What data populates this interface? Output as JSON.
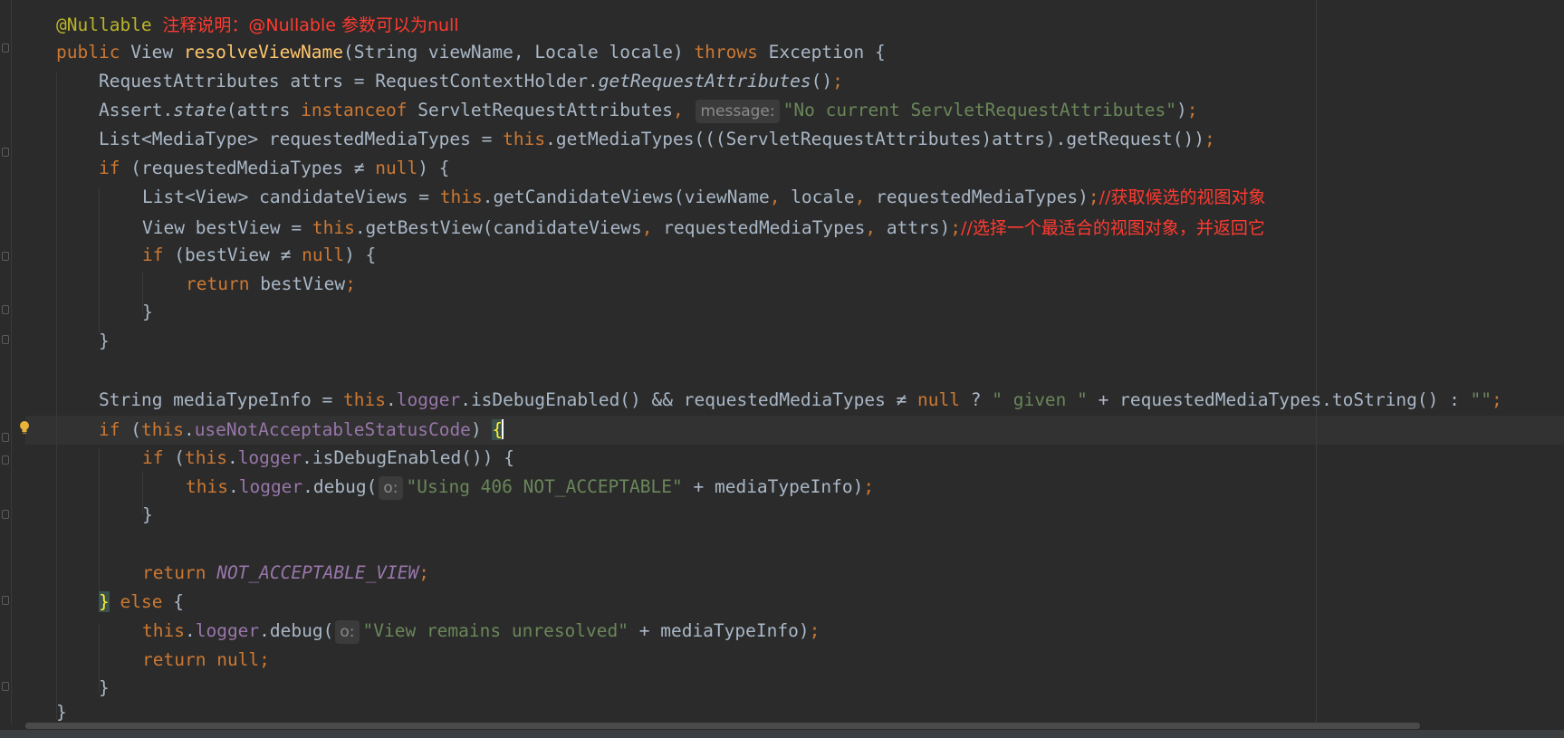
{
  "editor": {
    "annotation": "@Nullable",
    "annotation_comment": "注释说明：@Nullable 参数可以为null",
    "lines": {
      "l2": {
        "kw_public": "public",
        "type_view": " View ",
        "method": "resolveViewName",
        "params": "(String viewName, Locale locale) ",
        "kw_throws": "throws",
        "rest": " Exception {"
      },
      "l3": {
        "a": "RequestAttributes attrs = RequestContextHolder.",
        "m": "getRequestAttributes",
        "b": "()",
        "semi": ";"
      },
      "l4": {
        "a": "Assert.",
        "m": "state",
        "b": "(attrs ",
        "kw": "instanceof",
        "c": " ServletRequestAttributes",
        "comma": ",",
        "hint": "message:",
        "str": "\"No current ServletRequestAttributes\"",
        "d": ")",
        "semi": ";"
      },
      "l5": {
        "a": "List<MediaType> requestedMediaTypes = ",
        "kw": "this",
        "b": ".getMediaTypes(((ServletRequestAttributes)attrs).getRequest())",
        "semi": ";"
      },
      "l6": {
        "kw_if": "if",
        "a": " (requestedMediaTypes ≠ ",
        "kw_null": "null",
        "b": ") {"
      },
      "l7": {
        "a": "List<View> candidateViews = ",
        "kw": "this",
        "b": ".getCandidateViews(viewName",
        "c1": ",",
        "b2": " locale",
        "c2": ",",
        "b3": " requestedMediaTypes)",
        "semi": ";",
        "comment": "//获取候选的视图对象"
      },
      "l8": {
        "a": "View bestView = ",
        "kw": "this",
        "b": ".getBestView(candidateViews",
        "c1": ",",
        "b2": " requestedMediaTypes",
        "c2": ",",
        "b3": " attrs)",
        "semi": ";",
        "comment": "//选择一个最适合的视图对象，并返回它"
      },
      "l9": {
        "kw_if": "if",
        "a": " (bestView ≠ ",
        "kw_null": "null",
        "b": ") {"
      },
      "l10": {
        "kw": "return",
        "a": " bestView",
        "semi": ";"
      },
      "l11": {
        "a": "}"
      },
      "l12": {
        "a": "}"
      },
      "l14": {
        "a": "String mediaTypeInfo = ",
        "kw": "this",
        "dot": ".",
        "fld": "logger",
        "b": ".isDebugEnabled() && requestedMediaTypes ≠ ",
        "kw_null": "null",
        "c": " ? ",
        "str1": "\" given \"",
        "d": " + requestedMediaTypes.toString() : ",
        "str2": "\"\"",
        "semi": ";"
      },
      "l15": {
        "kw_if": "if",
        "a": " (",
        "kw": "this",
        "dot": ".",
        "fld": "useNotAcceptableStatusCode",
        "b": ") ",
        "brace": "{"
      },
      "l16": {
        "kw_if": "if",
        "a": " (",
        "kw": "this",
        "dot": ".",
        "fld": "logger",
        "b": ".isDebugEnabled()) {"
      },
      "l17": {
        "kw": "this",
        "dot": ".",
        "fld": "logger",
        "b": ".debug(",
        "hint": "o:",
        "str": "\"Using 406 NOT_ACCEPTABLE\"",
        "c": " + mediaTypeInfo)",
        "semi": ";"
      },
      "l18": {
        "a": "}"
      },
      "l20": {
        "kw": "return",
        "sp": " ",
        "sta": "NOT_ACCEPTABLE_VIEW",
        "semi": ";"
      },
      "l21": {
        "brace": "}",
        "sp": " ",
        "kw": "else",
        "b": " {"
      },
      "l22": {
        "kw": "this",
        "dot": ".",
        "fld": "logger",
        "b": ".debug(",
        "hint": "o:",
        "str": "\"View remains unresolved\"",
        "c": " + mediaTypeInfo)",
        "semi": ";"
      },
      "l23": {
        "kw": "return",
        "sp": " ",
        "kw_null": "null",
        "semi": ";"
      },
      "l24": {
        "a": "}"
      },
      "l25": {
        "a": "}"
      }
    }
  },
  "colors": {
    "background": "#2b2b2b",
    "keyword": "#cc7832",
    "annotation": "#bbb529",
    "method_decl": "#ffc66d",
    "string": "#6a8759",
    "field": "#9876aa",
    "default_text": "#a9b7c6",
    "chinese_comment": "#ff3b30"
  },
  "icons": {
    "gutter_bulb": "lightbulb-icon",
    "fold_marker": "fold-marker-icon"
  }
}
